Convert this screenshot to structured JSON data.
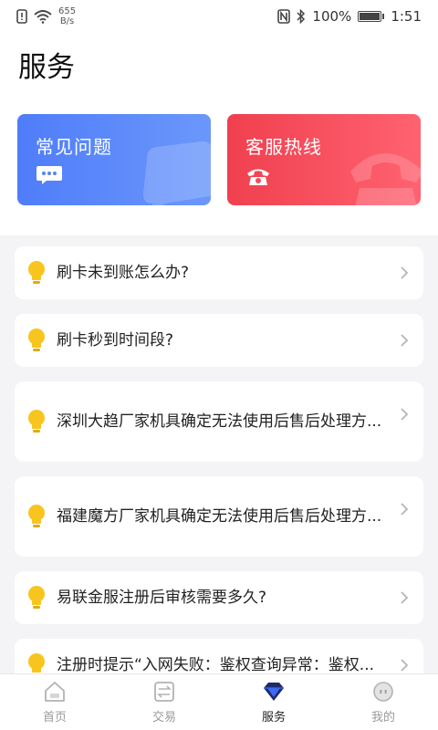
{
  "status_bar": {
    "net_speed_value": "655",
    "net_speed_unit": "B/s",
    "battery": "100%",
    "time": "1:51"
  },
  "page": {
    "title": "服务"
  },
  "cards": {
    "faq": {
      "label": "常见问题",
      "color": "#5683fa"
    },
    "hotline": {
      "label": "客服热线",
      "color": "#f54a58"
    }
  },
  "faq_items": [
    {
      "text": "刷卡未到账怎么办?"
    },
    {
      "text": "刷卡秒到时间段?"
    },
    {
      "text": "深圳大趋厂家机具确定无法使用后售后处理方..."
    },
    {
      "text": "福建魔方厂家机具确定无法使用后售后处理方..."
    },
    {
      "text": "易联金服注册后审核需要多久?"
    },
    {
      "text": "注册时提示“入网失败：鉴权查询异常：鉴权..."
    }
  ],
  "tabbar": {
    "home": "首页",
    "trade": "交易",
    "service": "服务",
    "mine": "我的"
  },
  "colors": {
    "bulb": "#f7c51e",
    "active_tab": "#3d6af0"
  }
}
